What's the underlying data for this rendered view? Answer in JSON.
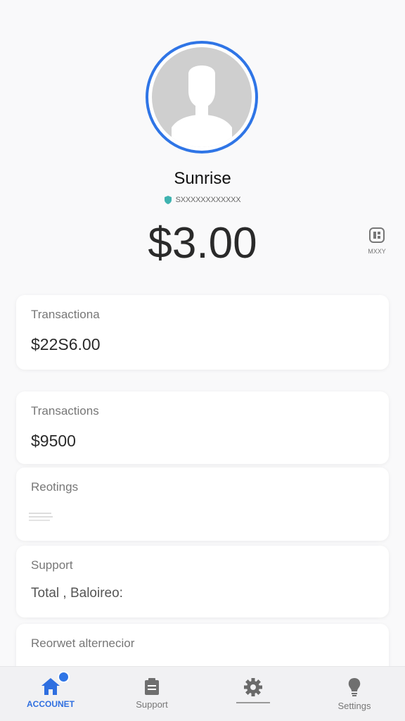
{
  "profile": {
    "username": "Sunrise",
    "subline": "SXXXXXXXXXXXX"
  },
  "balance": "$3.00",
  "side_button": {
    "label": "MXXY"
  },
  "cards": [
    {
      "title": "Transactiona",
      "value": "$22S6.00"
    },
    {
      "title": "Transactions",
      "value": "$9500"
    },
    {
      "title": "Reotings",
      "value": ""
    },
    {
      "title": "Support",
      "value": "Total , Baloireo:"
    },
    {
      "title": "Reorwet alternecior",
      "value": ""
    }
  ],
  "nav": [
    {
      "label": "ACCOUNET",
      "icon": "home-icon",
      "active": true
    },
    {
      "label": "Support",
      "icon": "clipboard-icon",
      "active": false
    },
    {
      "label": "",
      "icon": "gear-icon",
      "active": false
    },
    {
      "label": "Settings",
      "icon": "lightbulb-icon",
      "active": false
    }
  ],
  "colors": {
    "accent": "#2f75e6",
    "background": "#f9f9fa",
    "card": "#ffffff"
  }
}
